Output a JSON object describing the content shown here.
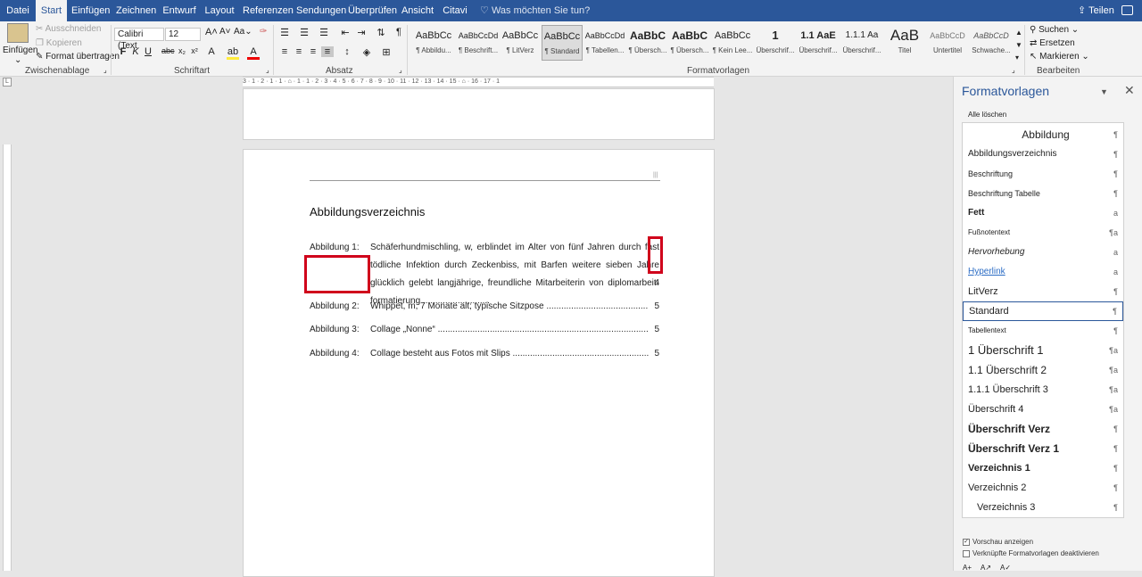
{
  "tabs": [
    "Datei",
    "Start",
    "Einfügen",
    "Zeichnen",
    "Entwurf",
    "Layout",
    "Referenzen",
    "Sendungen",
    "Überprüfen",
    "Ansicht",
    "Citavi"
  ],
  "tellme": "Was möchten Sie tun?",
  "share": "Teilen",
  "clipboard": {
    "paste": "Einfügen",
    "cut": "Ausschneiden",
    "copy": "Kopieren",
    "format_painter": "Format übertragen",
    "label": "Zwischenablage"
  },
  "font": {
    "name": "Calibri (Text",
    "size": "12",
    "aa": "Aa",
    "label": "Schriftart"
  },
  "paragraph": {
    "label": "Absatz"
  },
  "styles_gallery": [
    {
      "preview": "AaBbCc",
      "name": "¶ Abbildu..."
    },
    {
      "preview": "AaBbCcDd",
      "name": "¶ Beschrift..."
    },
    {
      "preview": "AaBbCc",
      "name": "¶ LitVerz"
    },
    {
      "preview": "AaBbCc",
      "name": "¶ Standard"
    },
    {
      "preview": "AaBbCcDd",
      "name": "¶ Tabellen..."
    },
    {
      "preview": "AaBbC",
      "name": "¶ Übersch..."
    },
    {
      "preview": "AaBbC",
      "name": "¶ Übersch..."
    },
    {
      "preview": "AaBbCc",
      "name": "¶ Kein Lee..."
    },
    {
      "preview": "1",
      "name": "Überschrif..."
    },
    {
      "preview": "1.1 AaE",
      "name": "Überschrif..."
    },
    {
      "preview": "1.1.1 Aa",
      "name": "Überschrif..."
    },
    {
      "preview": "AaB",
      "name": "Titel"
    },
    {
      "preview": "AaBbCcD",
      "name": "Untertitel"
    },
    {
      "preview": "AaBbCcD",
      "name": "Schwache..."
    }
  ],
  "styles_label": "Formatvorlagen",
  "editing": {
    "find": "Suchen",
    "replace": "Ersetzen",
    "select": "Markieren",
    "label": "Bearbeiten"
  },
  "ruler_text": "3 · 1 · 2 · 1 · 1 · ⌂ · 1 · 1 · 2 · 3 · 4 · 5 · 6 · 7 · 8 · 9 · 10 · 11 · 12 · 13 · 14 · 15 · ⌂ · 16 · 17 · 1",
  "document": {
    "title": "Abbildungsverzeichnis",
    "entries": [
      {
        "label": "Abbildung 1:",
        "text": "Schäferhundmischling, w, erblindet im Alter von fünf Jahren durch fast tödliche Infektion durch Zeckenbiss, mit Barfen weitere sieben Jahre glücklich gelebt langjährige, freundliche Mitarbeiterin von diplomarbeit-formatierung",
        "page": "4"
      },
      {
        "label": "Abbildung 2:",
        "text": "Whippet, m, 7 Monate alt; typische Sitzpose",
        "page": "5"
      },
      {
        "label": "Abbildung 3:",
        "text": "Collage „Nonne“",
        "page": "5"
      },
      {
        "label": "Abbildung 4:",
        "text": "Collage besteht aus Fotos mit Slips",
        "page": "5"
      }
    ]
  },
  "pane": {
    "title": "Formatvorlagen",
    "clear_all": "Alle löschen",
    "styles": [
      {
        "name": "Abbildung",
        "mark": "¶"
      },
      {
        "name": "Abbildungsverzeichnis",
        "mark": "¶"
      },
      {
        "name": "Beschriftung",
        "mark": "¶"
      },
      {
        "name": "Beschriftung Tabelle",
        "mark": "¶"
      },
      {
        "name": "Fett",
        "mark": "a"
      },
      {
        "name": "Fußnotentext",
        "mark": "¶a"
      },
      {
        "name": "Hervorhebung",
        "mark": "a"
      },
      {
        "name": "Hyperlink",
        "mark": "a"
      },
      {
        "name": "LitVerz",
        "mark": "¶"
      },
      {
        "name": "Standard",
        "mark": "¶"
      },
      {
        "name": "Tabellentext",
        "mark": "¶"
      },
      {
        "name": "1  Überschrift 1",
        "mark": "¶a"
      },
      {
        "name": "1.1  Überschrift 2",
        "mark": "¶a"
      },
      {
        "name": "1.1.1  Überschrift 3",
        "mark": "¶a"
      },
      {
        "name": "Überschrift 4",
        "mark": "¶a"
      },
      {
        "name": "Überschrift Verz",
        "mark": "¶"
      },
      {
        "name": "Überschrift Verz 1",
        "mark": "¶"
      },
      {
        "name": "Verzeichnis 1",
        "mark": "¶"
      },
      {
        "name": "Verzeichnis 2",
        "mark": "¶"
      },
      {
        "name": "Verzeichnis 3",
        "mark": "¶"
      }
    ],
    "show_preview": "Vorschau anzeigen",
    "disable_linked": "Verknüpfte Formatvorlagen deaktivieren",
    "show_preview_checked": true,
    "disable_linked_checked": false
  },
  "colors": {
    "ribbon_blue": "#2b579a",
    "highlight_red": "#d0021b"
  }
}
